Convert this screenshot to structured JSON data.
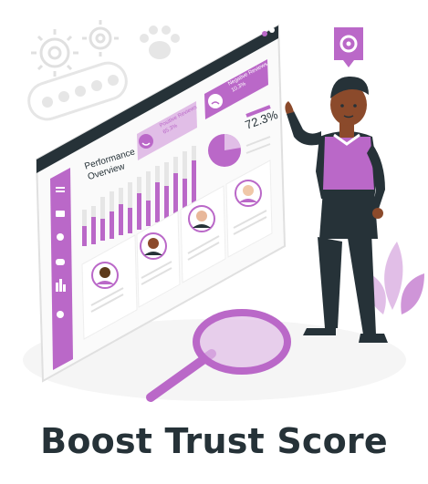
{
  "heading": "Boost Trust Score",
  "dashboard": {
    "title_line1": "Performance",
    "title_line2": "Overview",
    "positive_title": "Positive Reviews",
    "positive_pct": "65.3%",
    "negative_title": "Negative Reviews",
    "negative_pct": "10.3%",
    "score": "72.3%"
  },
  "colors": {
    "accent": "#BA68C8",
    "accent_light": "#E1BEE7",
    "dark": "#263238",
    "skin": "#8B4A2B"
  },
  "icons": [
    "gear-icon",
    "paw-icon",
    "star-icon",
    "menu-icon",
    "mail-icon",
    "bell-icon",
    "chat-icon",
    "chart-icon",
    "settings-icon",
    "magnifier-icon"
  ]
}
